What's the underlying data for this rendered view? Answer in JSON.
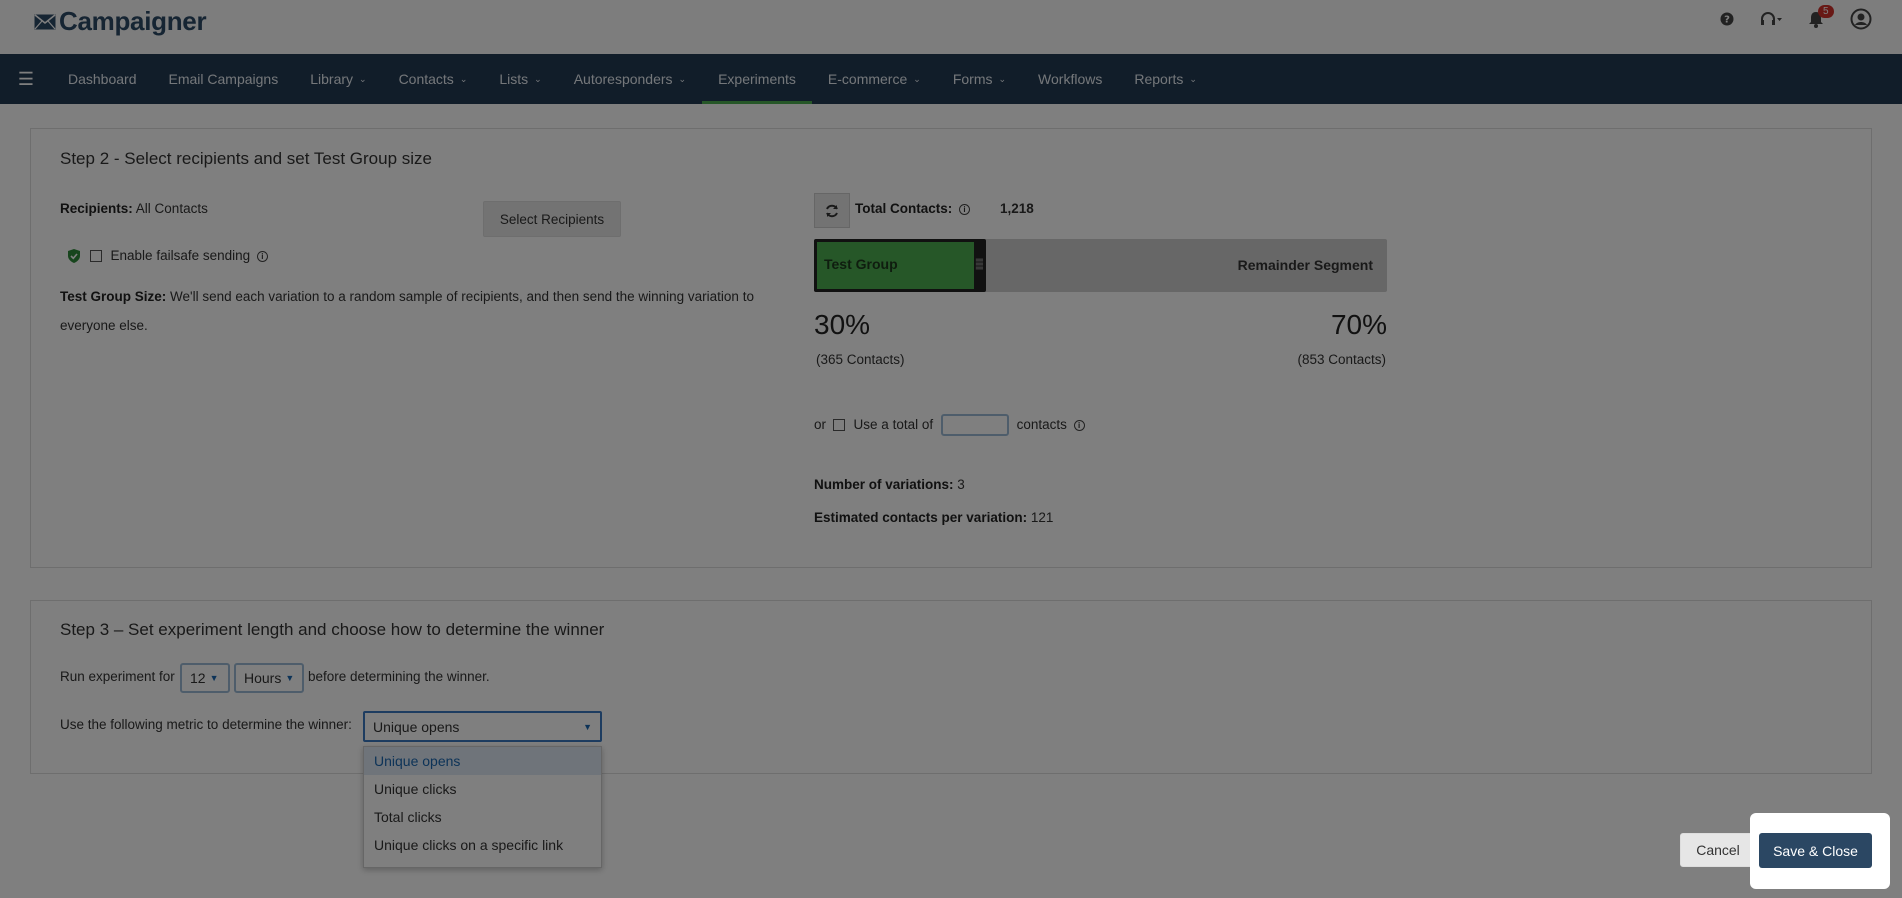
{
  "app": {
    "logo_text": "Campaigner",
    "notification_count": "5"
  },
  "nav": {
    "items": [
      {
        "label": "Dashboard",
        "has_caret": false,
        "active": false
      },
      {
        "label": "Email Campaigns",
        "has_caret": false,
        "active": false
      },
      {
        "label": "Library",
        "has_caret": true,
        "active": false
      },
      {
        "label": "Contacts",
        "has_caret": true,
        "active": false
      },
      {
        "label": "Lists",
        "has_caret": true,
        "active": false
      },
      {
        "label": "Autoresponders",
        "has_caret": true,
        "active": false
      },
      {
        "label": "Experiments",
        "has_caret": false,
        "active": true
      },
      {
        "label": "E-commerce",
        "has_caret": true,
        "active": false
      },
      {
        "label": "Forms",
        "has_caret": true,
        "active": false
      },
      {
        "label": "Workflows",
        "has_caret": false,
        "active": false
      },
      {
        "label": "Reports",
        "has_caret": true,
        "active": false
      }
    ]
  },
  "step2": {
    "title": "Step 2 - Select recipients and set Test Group size",
    "recipients_label": "Recipients:",
    "recipients_value": "All Contacts",
    "select_recipients_button": "Select Recipients",
    "failsafe_label": "Enable failsafe sending",
    "test_group_size_label": "Test Group Size:",
    "test_group_size_text": "We'll send each variation to a random sample of recipients, and then send the winning variation to everyone else.",
    "total_contacts_label": "Total Contacts:",
    "total_contacts_value": "1,218",
    "test_group_label": "Test Group",
    "remainder_label": "Remainder Segment",
    "test_group_fraction": 0.3,
    "test_pct": "30%",
    "test_contacts": "(365 Contacts)",
    "remainder_pct": "70%",
    "remainder_contacts": "(853 Contacts)",
    "or_label": "or",
    "use_total_label": "Use a total of",
    "contacts_label": "contacts",
    "num_variations_label": "Number of variations:",
    "num_variations_value": "3",
    "est_contacts_label": "Estimated contacts per variation:",
    "est_contacts_value": "121"
  },
  "step3": {
    "title": "Step 3 – Set experiment length and choose how to determine the winner",
    "run_for_label": "Run experiment for",
    "duration_value": "12",
    "duration_unit": "Hours",
    "before_label": "before determining the winner.",
    "metric_label": "Use the following metric to determine the winner:",
    "metric_value": "Unique opens",
    "metric_options": [
      "Unique opens",
      "Unique clicks",
      "Total clicks",
      "Unique clicks on a specific link"
    ]
  },
  "footer": {
    "cancel_label": "Cancel",
    "save_label": "Save & Close"
  }
}
